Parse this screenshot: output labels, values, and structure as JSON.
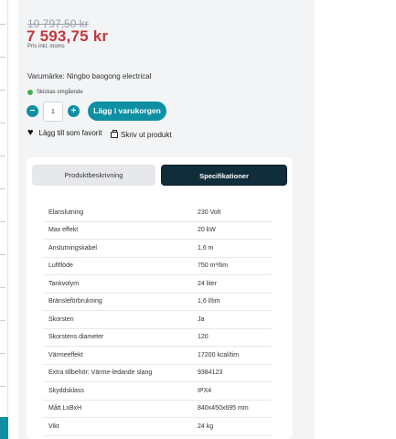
{
  "product": {
    "old_price": "10 797,50 kr",
    "price": "7 593,75 kr",
    "price_note": "Pris inkl. moms",
    "brand_line": "Varumärke: Ningbo baogong electrical",
    "shipping_text": "Skickas omgående",
    "quantity": "1",
    "minus_symbol": "−",
    "plus_symbol": "+",
    "add_to_cart_label": "Lägg i varukorgen",
    "favorite_label": "Lägg till som favorit",
    "print_label": "Skriv ut produkt"
  },
  "tabs": [
    {
      "label": "Produktbeskrivning",
      "active": false
    },
    {
      "label": "Specifikationer",
      "active": true
    }
  ],
  "specs": [
    {
      "key": "Elanslutning",
      "value": "230 Volt"
    },
    {
      "key": "Max effekt",
      "value": "20 kW"
    },
    {
      "key": "Anslutningskabel",
      "value": "1,6 m"
    },
    {
      "key": "Luftflöde",
      "value": "750 m³/tim"
    },
    {
      "key": "Tankvolym",
      "value": "24 liter"
    },
    {
      "key": "Bränsleförbrukning",
      "value": "1,6 l/tim"
    },
    {
      "key": "Skorsten",
      "value": "Ja"
    },
    {
      "key": "Skorstens diameter",
      "value": "120"
    },
    {
      "key": "Värmeeffekt",
      "value": "17200 kcal/tim"
    },
    {
      "key": "Extra tillbehör: Värme-ledande slang",
      "value": "9384123"
    },
    {
      "key": "Skyddsklass",
      "value": "IPX4"
    },
    {
      "key": "Mått LxBxH",
      "value": "840x450x695 mm"
    },
    {
      "key": "Vikt",
      "value": "24 kg"
    }
  ],
  "colors": {
    "accent": "#0f8fa3",
    "price": "#c2383b",
    "active_tab": "#0f2d3a",
    "in_stock": "#3fb34f"
  },
  "icons": {
    "favorite": "heart-icon",
    "print": "printer-icon",
    "shipping": "status-dot-icon"
  }
}
